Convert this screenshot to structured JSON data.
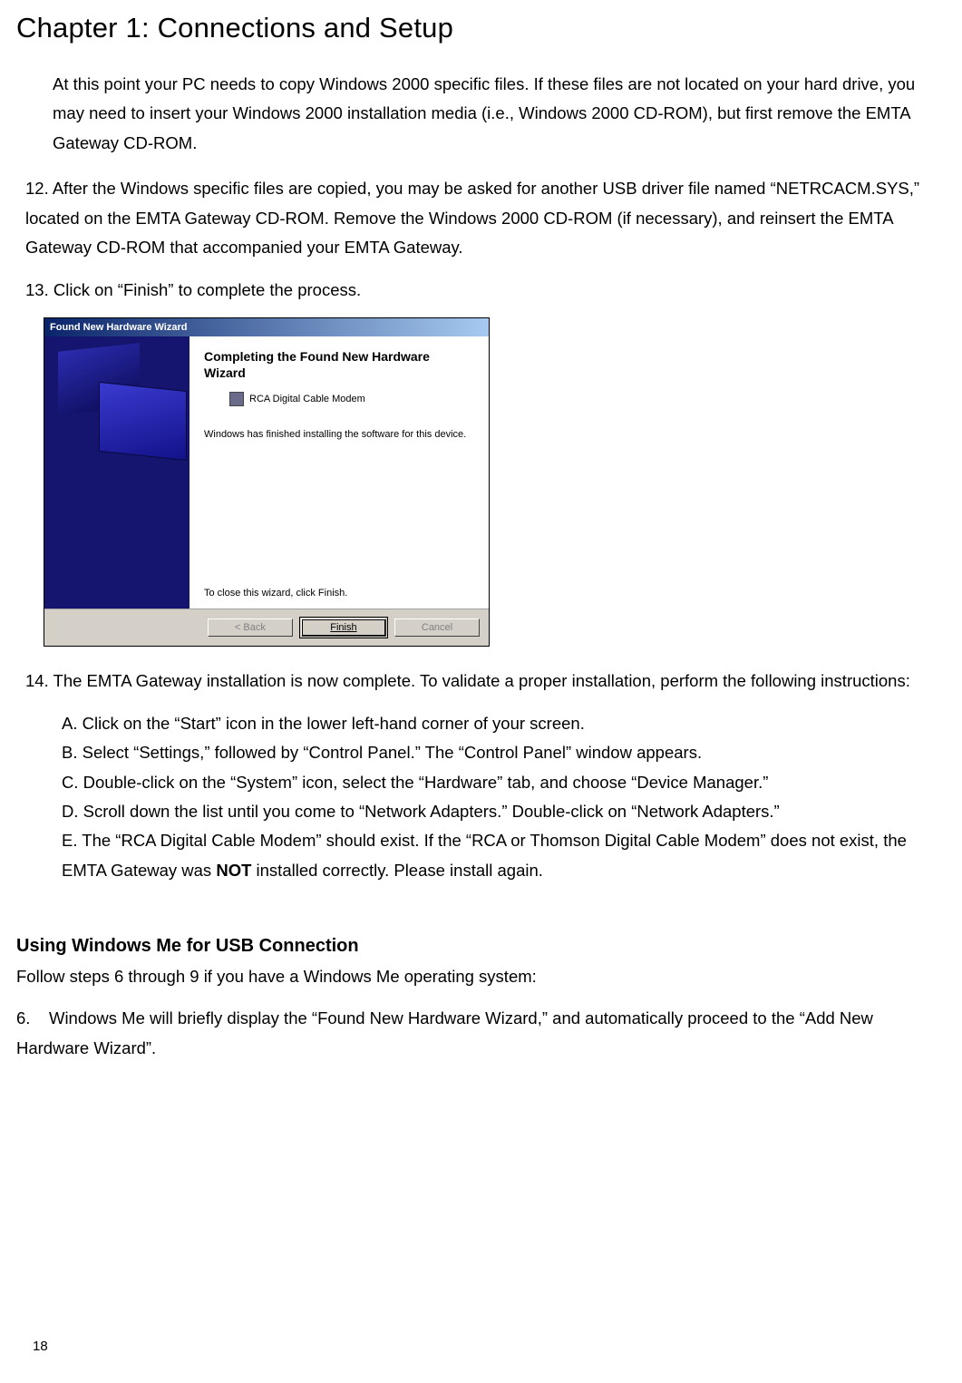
{
  "chapter_title": "Chapter 1: Connections and Setup",
  "intro_para": "At this point your PC needs to copy Windows 2000 specific files. If these files are not located on your hard drive, you may need to insert your Windows 2000 installation media (i.e., Windows 2000 CD-ROM), but first remove the EMTA Gateway CD-ROM.",
  "step12": "12. After the Windows specific files are copied, you may be asked for another USB driver file named “NETRCACM.SYS,” located on the EMTA Gateway CD-ROM. Remove the Windows 2000 CD-ROM (if necessary), and reinsert the EMTA Gateway CD-ROM that accompanied your EMTA Gateway.",
  "step13": "13. Click on “Finish” to complete the process.",
  "wizard": {
    "title": "Found New Hardware Wizard",
    "heading": "Completing the Found New Hardware Wizard",
    "device": "RCA Digital Cable Modem",
    "msg": "Windows has finished installing the software for this device.",
    "close_hint": "To close this wizard, click Finish.",
    "back": "< Back",
    "finish": "Finish",
    "cancel": "Cancel"
  },
  "step14_intro": "14. The EMTA Gateway installation is now complete. To validate a proper installation, perform the following instructions:",
  "step14": {
    "a": "A. Click on the “Start” icon in the lower left-hand corner of your screen.",
    "b": "B. Select “Settings,” followed by “Control Panel.” The “Control Panel” window appears.",
    "c": "C. Double-click on the “System” icon, select the “Hardware” tab, and choose “Device Manager.”",
    "d": "D. Scroll down the list until you come to “Network Adapters.” Double-click on “Network Adapters.”",
    "e_pre": "E. The “RCA Digital Cable Modem” should exist. If the “RCA or Thomson Digital Cable Modem” does not exist, the EMTA Gateway was ",
    "e_not": "NOT",
    "e_post": " installed correctly. Please install again."
  },
  "section_me": "Using Windows Me for USB Connection",
  "me_follow": "Follow steps 6 through 9 if you have a Windows Me operating system:",
  "step6": "6.    Windows Me will briefly display the “Found New Hardware Wizard,” and automatically proceed to the “Add New Hardware Wizard”.",
  "page_number": "18"
}
